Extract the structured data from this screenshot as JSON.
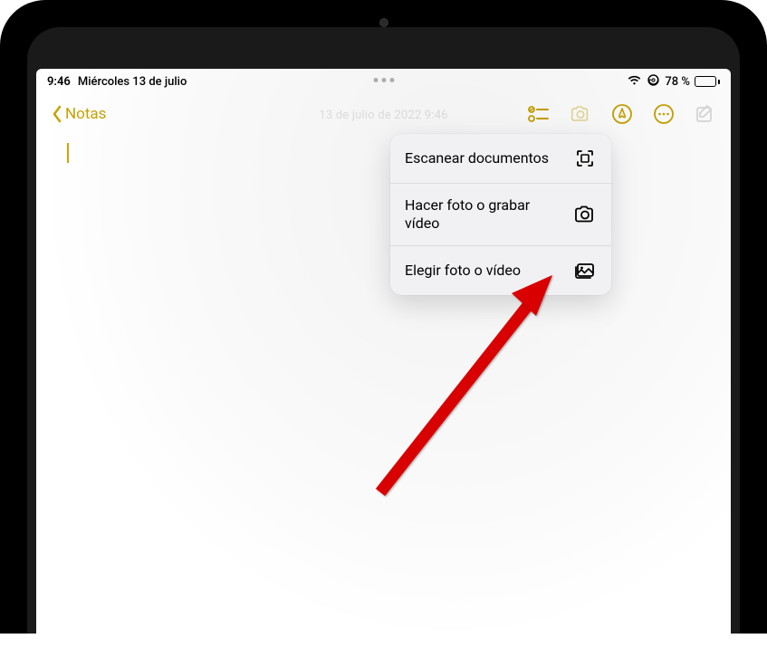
{
  "status": {
    "time": "9:46",
    "date": "Miércoles 13 de julio",
    "battery_percent": "78 %",
    "wifi": true,
    "orientation_lock": true
  },
  "nav": {
    "back_label": "Notas"
  },
  "note": {
    "date_text": "13 de julio de 2022 9:46"
  },
  "popover": {
    "items": [
      {
        "label": "Escanear documentos",
        "icon": "scan-icon"
      },
      {
        "label": "Hacer foto o grabar vídeo",
        "icon": "camera-icon"
      },
      {
        "label": "Elegir foto o vídeo",
        "icon": "gallery-icon"
      }
    ]
  },
  "colors": {
    "accent": "#c7a100"
  }
}
